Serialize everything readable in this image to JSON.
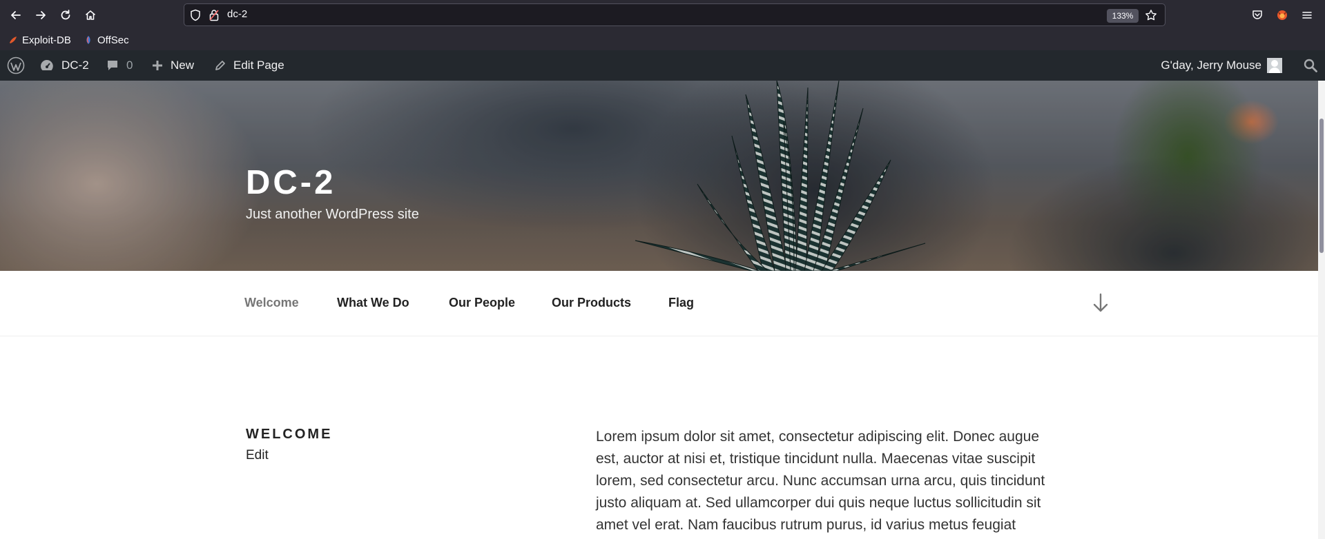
{
  "browser": {
    "url": "dc-2",
    "zoom": "133%",
    "bookmarks": [
      {
        "label": "Exploit-DB",
        "icon": "exploit-db-icon"
      },
      {
        "label": "OffSec",
        "icon": "offsec-icon"
      }
    ],
    "nav_icons": [
      "back-icon",
      "forward-icon",
      "reload-icon",
      "home-icon"
    ],
    "right_icons": [
      "pocket-icon",
      "firefox-account-icon",
      "menu-icon"
    ]
  },
  "admin_bar": {
    "site_name": "DC-2",
    "comments_count": "0",
    "new_label": "New",
    "edit_label": "Edit Page",
    "greeting": "G'day, Jerry Mouse"
  },
  "header": {
    "site_title": "DC-2",
    "tagline": "Just another WordPress site"
  },
  "nav": {
    "items": [
      "Welcome",
      "What We Do",
      "Our People",
      "Our Products",
      "Flag"
    ],
    "current": "Welcome"
  },
  "page": {
    "title": "WELCOME",
    "edit": "Edit",
    "lines": [
      "Lorem ipsum dolor sit amet, consectetur adipiscing elit. Donec augue",
      "est, auctor at nisi et, tristique tincidunt nulla. Maecenas vitae suscipit",
      "lorem, sed consectetur arcu. Nunc accumsan urna arcu, quis tincidunt",
      "justo aliquam at. Sed ullamcorper dui quis neque luctus sollicitudin sit",
      "amet vel erat. Nam faucibus rutrum purus, id varius metus feugiat"
    ]
  },
  "colors": {
    "browser_chrome": "#2b2a33",
    "admin_bar": "#23282d",
    "nav_current": "#767676",
    "text": "#222222"
  }
}
